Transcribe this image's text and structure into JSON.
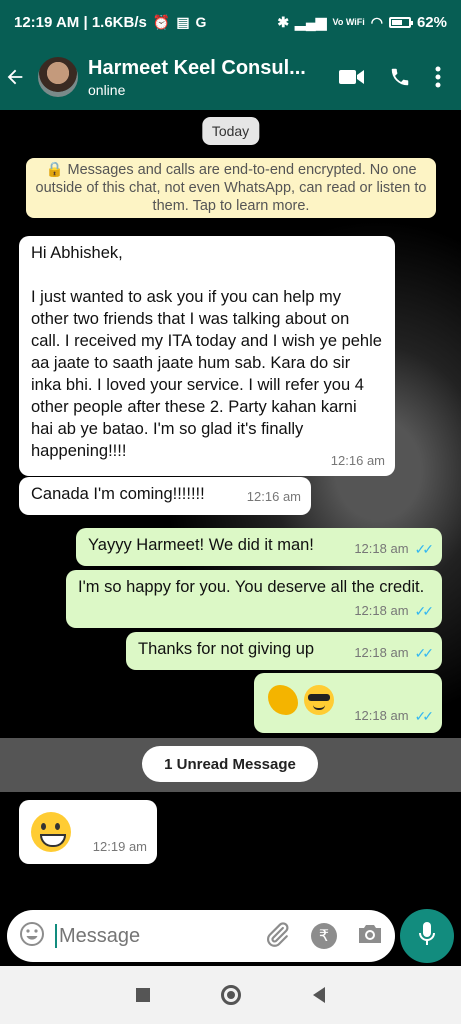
{
  "status_bar": {
    "left_text": "12:19 AM | 1.6KB/s",
    "network": "Vo WiFi",
    "battery": "62%",
    "battery_level": 0.62
  },
  "header": {
    "title": "Harmeet Keel Consul...",
    "subtitle": "online",
    "icons": [
      "back-arrow-icon",
      "video-call-icon",
      "phone-icon",
      "more-vert-icon"
    ]
  },
  "chat": {
    "date_label": "Today",
    "encryption_notice": "🔒 Messages and calls are end-to-end encrypted. No one outside of this chat, not even WhatsApp, can read or listen to them. Tap to learn more.",
    "messages": [
      {
        "direction": "in",
        "text": "Hi Abhishek,\n\nI just wanted to ask you if you can help my other two friends that I was talking about on call. I received my ITA today and I wish ye pehle aa jaate to saath jaate hum sab. Kara do sir inka bhi. I loved your service. I will refer you 4 other people after these 2. Party kahan karni hai ab ye batao. I'm so glad it's finally happening!!!!",
        "time": "12:16 am"
      },
      {
        "direction": "in",
        "text": "Canada I'm coming!!!!!!!",
        "time": "12:16 am"
      },
      {
        "direction": "out",
        "text": "Yayyy Harmeet! We did it man!",
        "time": "12:18 am",
        "ticks": "✓✓"
      },
      {
        "direction": "out",
        "text": "I'm so happy for you. You deserve all the credit.",
        "time": "12:18 am",
        "ticks": "✓✓"
      },
      {
        "direction": "out",
        "text": "Thanks for not giving up",
        "time": "12:18 am",
        "ticks": "✓✓"
      },
      {
        "direction": "out",
        "emojis": [
          "flexed-biceps",
          "smiling-face-with-sunglasses"
        ],
        "time": "12:18 am",
        "ticks": "✓✓"
      },
      {
        "direction": "in",
        "emojis": [
          "grinning-face"
        ],
        "time": "12:19 am"
      }
    ],
    "unread_label": "1 Unread Message"
  },
  "composer": {
    "placeholder": "Message",
    "rupee_symbol": "₹"
  },
  "colors": {
    "header": "#075e54",
    "outgoing_bubble": "#dcf8c6",
    "incoming_bubble": "#ffffff",
    "mic_button": "#128c7e",
    "read_ticks": "#34b7f1",
    "notice_bg": "#fdf4c5"
  }
}
